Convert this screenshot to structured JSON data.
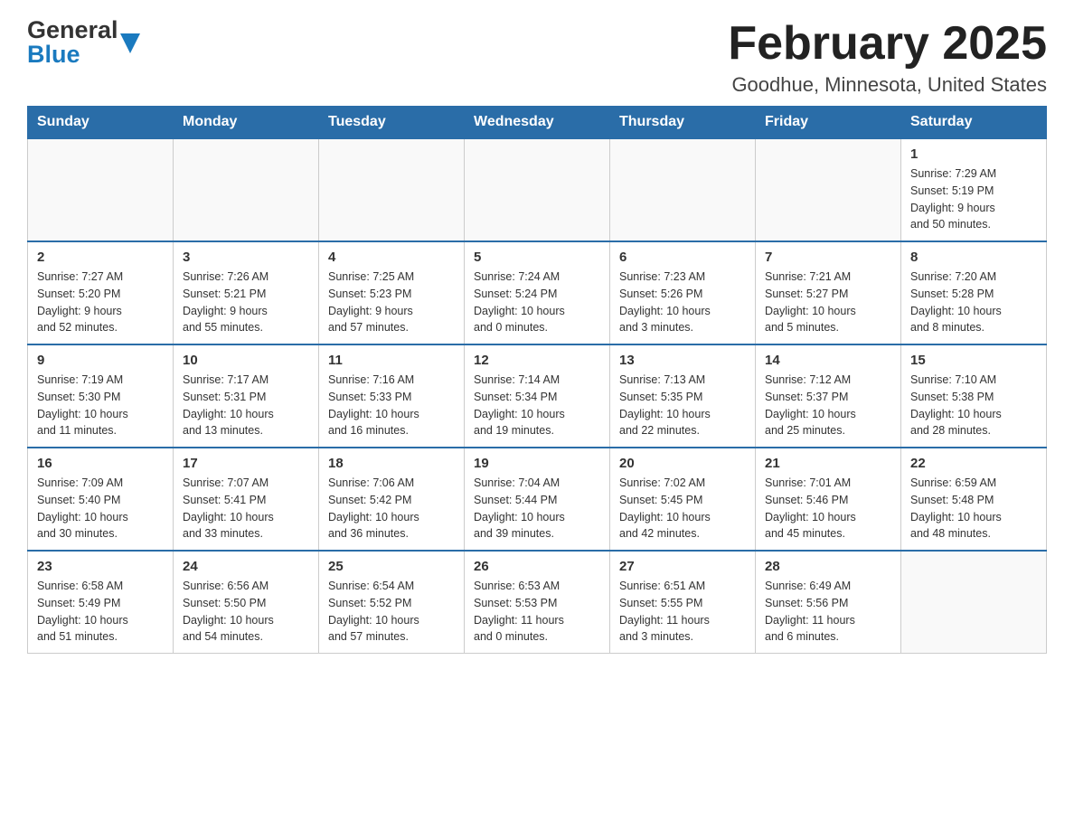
{
  "logo": {
    "general": "General",
    "blue": "Blue",
    "triangle": "▲"
  },
  "title": "February 2025",
  "subtitle": "Goodhue, Minnesota, United States",
  "weekdays": [
    "Sunday",
    "Monday",
    "Tuesday",
    "Wednesday",
    "Thursday",
    "Friday",
    "Saturday"
  ],
  "weeks": [
    [
      {
        "day": "",
        "info": ""
      },
      {
        "day": "",
        "info": ""
      },
      {
        "day": "",
        "info": ""
      },
      {
        "day": "",
        "info": ""
      },
      {
        "day": "",
        "info": ""
      },
      {
        "day": "",
        "info": ""
      },
      {
        "day": "1",
        "info": "Sunrise: 7:29 AM\nSunset: 5:19 PM\nDaylight: 9 hours\nand 50 minutes."
      }
    ],
    [
      {
        "day": "2",
        "info": "Sunrise: 7:27 AM\nSunset: 5:20 PM\nDaylight: 9 hours\nand 52 minutes."
      },
      {
        "day": "3",
        "info": "Sunrise: 7:26 AM\nSunset: 5:21 PM\nDaylight: 9 hours\nand 55 minutes."
      },
      {
        "day": "4",
        "info": "Sunrise: 7:25 AM\nSunset: 5:23 PM\nDaylight: 9 hours\nand 57 minutes."
      },
      {
        "day": "5",
        "info": "Sunrise: 7:24 AM\nSunset: 5:24 PM\nDaylight: 10 hours\nand 0 minutes."
      },
      {
        "day": "6",
        "info": "Sunrise: 7:23 AM\nSunset: 5:26 PM\nDaylight: 10 hours\nand 3 minutes."
      },
      {
        "day": "7",
        "info": "Sunrise: 7:21 AM\nSunset: 5:27 PM\nDaylight: 10 hours\nand 5 minutes."
      },
      {
        "day": "8",
        "info": "Sunrise: 7:20 AM\nSunset: 5:28 PM\nDaylight: 10 hours\nand 8 minutes."
      }
    ],
    [
      {
        "day": "9",
        "info": "Sunrise: 7:19 AM\nSunset: 5:30 PM\nDaylight: 10 hours\nand 11 minutes."
      },
      {
        "day": "10",
        "info": "Sunrise: 7:17 AM\nSunset: 5:31 PM\nDaylight: 10 hours\nand 13 minutes."
      },
      {
        "day": "11",
        "info": "Sunrise: 7:16 AM\nSunset: 5:33 PM\nDaylight: 10 hours\nand 16 minutes."
      },
      {
        "day": "12",
        "info": "Sunrise: 7:14 AM\nSunset: 5:34 PM\nDaylight: 10 hours\nand 19 minutes."
      },
      {
        "day": "13",
        "info": "Sunrise: 7:13 AM\nSunset: 5:35 PM\nDaylight: 10 hours\nand 22 minutes."
      },
      {
        "day": "14",
        "info": "Sunrise: 7:12 AM\nSunset: 5:37 PM\nDaylight: 10 hours\nand 25 minutes."
      },
      {
        "day": "15",
        "info": "Sunrise: 7:10 AM\nSunset: 5:38 PM\nDaylight: 10 hours\nand 28 minutes."
      }
    ],
    [
      {
        "day": "16",
        "info": "Sunrise: 7:09 AM\nSunset: 5:40 PM\nDaylight: 10 hours\nand 30 minutes."
      },
      {
        "day": "17",
        "info": "Sunrise: 7:07 AM\nSunset: 5:41 PM\nDaylight: 10 hours\nand 33 minutes."
      },
      {
        "day": "18",
        "info": "Sunrise: 7:06 AM\nSunset: 5:42 PM\nDaylight: 10 hours\nand 36 minutes."
      },
      {
        "day": "19",
        "info": "Sunrise: 7:04 AM\nSunset: 5:44 PM\nDaylight: 10 hours\nand 39 minutes."
      },
      {
        "day": "20",
        "info": "Sunrise: 7:02 AM\nSunset: 5:45 PM\nDaylight: 10 hours\nand 42 minutes."
      },
      {
        "day": "21",
        "info": "Sunrise: 7:01 AM\nSunset: 5:46 PM\nDaylight: 10 hours\nand 45 minutes."
      },
      {
        "day": "22",
        "info": "Sunrise: 6:59 AM\nSunset: 5:48 PM\nDaylight: 10 hours\nand 48 minutes."
      }
    ],
    [
      {
        "day": "23",
        "info": "Sunrise: 6:58 AM\nSunset: 5:49 PM\nDaylight: 10 hours\nand 51 minutes."
      },
      {
        "day": "24",
        "info": "Sunrise: 6:56 AM\nSunset: 5:50 PM\nDaylight: 10 hours\nand 54 minutes."
      },
      {
        "day": "25",
        "info": "Sunrise: 6:54 AM\nSunset: 5:52 PM\nDaylight: 10 hours\nand 57 minutes."
      },
      {
        "day": "26",
        "info": "Sunrise: 6:53 AM\nSunset: 5:53 PM\nDaylight: 11 hours\nand 0 minutes."
      },
      {
        "day": "27",
        "info": "Sunrise: 6:51 AM\nSunset: 5:55 PM\nDaylight: 11 hours\nand 3 minutes."
      },
      {
        "day": "28",
        "info": "Sunrise: 6:49 AM\nSunset: 5:56 PM\nDaylight: 11 hours\nand 6 minutes."
      },
      {
        "day": "",
        "info": ""
      }
    ]
  ]
}
